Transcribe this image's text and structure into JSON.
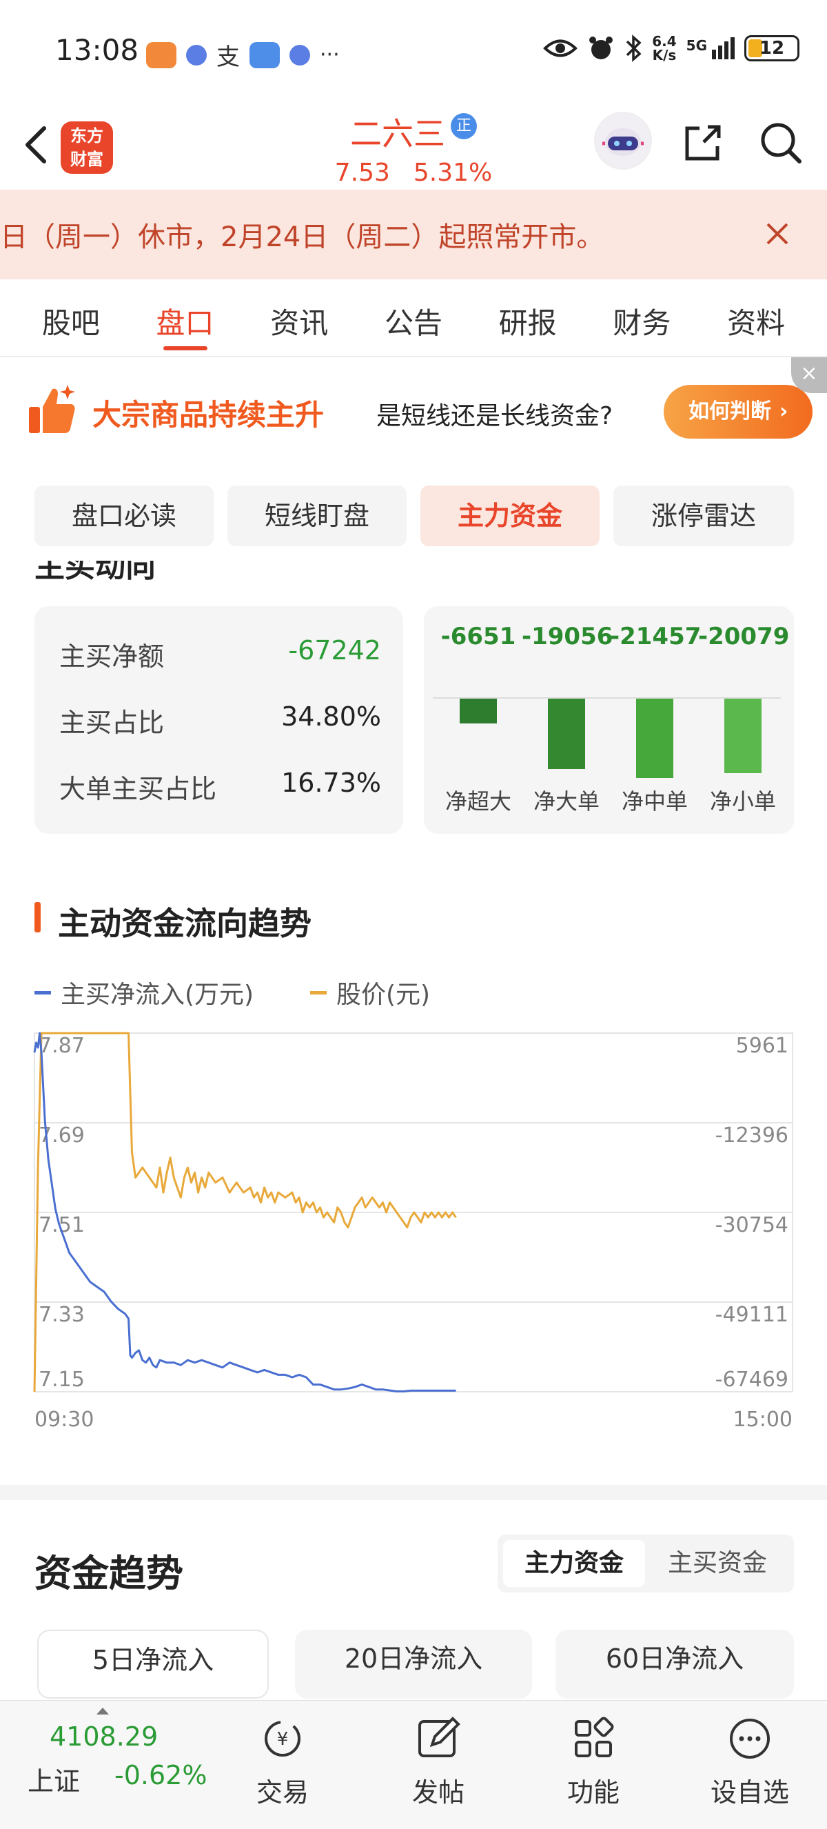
{
  "status_bar": {
    "time": "13:08",
    "net_speed_top": "6.4",
    "net_speed_bottom": "K/s",
    "network": "5G",
    "battery": "12"
  },
  "header": {
    "logo_line1": "东方",
    "logo_line2": "财富",
    "stock_name": "二六三",
    "badge": "正",
    "price": "7.53",
    "change_pct": "5.31%"
  },
  "notice": {
    "text": "日（周一）休市，2月24日（周二）起照常开市。"
  },
  "tabs": [
    {
      "label": "股吧"
    },
    {
      "label": "盘口"
    },
    {
      "label": "资讯"
    },
    {
      "label": "公告"
    },
    {
      "label": "研报"
    },
    {
      "label": "财务"
    },
    {
      "label": "资料"
    }
  ],
  "banner": {
    "headline": "大宗商品持续主升",
    "subline": "是短线还是长线资金?",
    "cta": "如何判断"
  },
  "subtabs": [
    {
      "label": "盘口必读"
    },
    {
      "label": "短线盯盘"
    },
    {
      "label": "主力资金"
    },
    {
      "label": "涨停雷达"
    }
  ],
  "main_buy": {
    "section_peek": "主买动向",
    "rows": [
      {
        "label": "主买净额",
        "value": "-67242"
      },
      {
        "label": "主买占比",
        "value": "34.80%"
      },
      {
        "label": "大单主买占比",
        "value": "16.73%"
      }
    ]
  },
  "flow_breakdown": {
    "items": [
      {
        "label": "净超大",
        "value": "-6651",
        "amount": -6651,
        "color": "#2e7d2e"
      },
      {
        "label": "净大单",
        "value": "-19056",
        "amount": -19056,
        "color": "#34882f"
      },
      {
        "label": "净中单",
        "value": "-21457",
        "amount": -21457,
        "color": "#46a83b"
      },
      {
        "label": "净小单",
        "value": "-20079",
        "amount": -20079,
        "color": "#5bb84d"
      }
    ]
  },
  "trend_chart": {
    "title": "主动资金流向趋势",
    "legend": [
      {
        "name": "主买净流入(万元)",
        "color": "#4a6fd1"
      },
      {
        "name": "股价(元)",
        "color": "#e8a93a"
      }
    ],
    "left_ticks": [
      "7.87",
      "7.69",
      "7.51",
      "7.33",
      "7.15"
    ],
    "right_ticks": [
      "5961",
      "-12396",
      "-30754",
      "-49111",
      "-67469"
    ],
    "x_start": "09:30",
    "x_end": "15:00"
  },
  "chart_data": {
    "type": "line",
    "x_range": [
      "09:30",
      "15:00"
    ],
    "y_left": {
      "label": "股价(元)",
      "ylim": [
        7.15,
        7.87
      ]
    },
    "y_right": {
      "label": "主买净流入(万元)",
      "ylim": [
        -67469,
        5961
      ]
    },
    "grid": true,
    "series": [
      {
        "name": "股价(元)",
        "axis": "left",
        "color": "#e8a93a",
        "x": [
          0,
          2,
          4,
          6,
          10,
          20,
          40,
          50,
          54,
          56,
          58,
          62,
          66,
          70,
          72,
          74,
          76,
          78,
          80,
          82,
          84,
          86,
          88,
          90,
          92,
          94,
          96,
          98,
          100,
          104,
          108,
          112,
          116,
          120,
          124,
          126,
          128,
          130,
          132,
          134,
          136,
          138,
          140,
          144,
          148,
          150,
          152,
          154,
          156,
          158,
          160,
          162,
          164,
          166,
          168,
          170,
          172,
          174,
          176,
          178,
          180,
          182,
          184,
          186,
          188,
          190,
          192,
          194,
          196,
          198,
          200,
          202,
          204,
          206,
          208,
          210,
          212,
          214,
          216,
          218,
          220,
          222,
          224,
          226,
          228,
          230,
          232,
          234,
          236,
          238,
          240,
          242
        ],
        "y": [
          7.15,
          7.6,
          7.87,
          7.87,
          7.87,
          7.87,
          7.87,
          7.87,
          7.87,
          7.63,
          7.58,
          7.6,
          7.58,
          7.56,
          7.6,
          7.55,
          7.59,
          7.62,
          7.58,
          7.56,
          7.54,
          7.58,
          7.6,
          7.57,
          7.59,
          7.55,
          7.58,
          7.56,
          7.59,
          7.57,
          7.58,
          7.55,
          7.57,
          7.55,
          7.56,
          7.54,
          7.55,
          7.53,
          7.56,
          7.54,
          7.55,
          7.53,
          7.55,
          7.54,
          7.55,
          7.53,
          7.54,
          7.51,
          7.53,
          7.52,
          7.53,
          7.51,
          7.52,
          7.5,
          7.51,
          7.5,
          7.49,
          7.52,
          7.51,
          7.49,
          7.48,
          7.5,
          7.52,
          7.53,
          7.54,
          7.52,
          7.53,
          7.54,
          7.53,
          7.52,
          7.53,
          7.51,
          7.53,
          7.52,
          7.51,
          7.5,
          7.49,
          7.48,
          7.5,
          7.51,
          7.5,
          7.49,
          7.51,
          7.5,
          7.51,
          7.5,
          7.51,
          7.5,
          7.51,
          7.5,
          7.51,
          7.5
        ]
      },
      {
        "name": "主买净流入(万元)",
        "axis": "right",
        "color": "#4a6fd1",
        "x": [
          0,
          1,
          2,
          3,
          4,
          6,
          8,
          10,
          12,
          14,
          16,
          18,
          20,
          24,
          28,
          32,
          36,
          40,
          44,
          48,
          52,
          54,
          55,
          56,
          58,
          60,
          62,
          64,
          66,
          68,
          70,
          72,
          76,
          80,
          84,
          88,
          92,
          96,
          100,
          104,
          108,
          112,
          116,
          120,
          124,
          128,
          132,
          136,
          140,
          144,
          148,
          152,
          156,
          160,
          164,
          168,
          172,
          176,
          180,
          184,
          188,
          192,
          196,
          200,
          204,
          208,
          212,
          216,
          220,
          224,
          228,
          232,
          236,
          240,
          242
        ],
        "y": [
          2000,
          4000,
          3000,
          5961,
          2000,
          -12000,
          -20000,
          -25000,
          -30000,
          -33000,
          -35000,
          -37000,
          -39000,
          -41000,
          -43000,
          -45000,
          -46000,
          -47000,
          -49000,
          -50500,
          -51500,
          -52500,
          -60000,
          -60500,
          -59500,
          -59000,
          -61000,
          -61500,
          -60500,
          -62000,
          -62500,
          -61000,
          -61500,
          -61500,
          -62000,
          -61000,
          -61500,
          -61000,
          -61500,
          -62000,
          -62500,
          -61500,
          -62000,
          -62500,
          -63000,
          -63500,
          -63000,
          -63500,
          -64000,
          -64000,
          -64500,
          -64000,
          -64500,
          -66000,
          -66000,
          -66500,
          -67000,
          -67000,
          -66800,
          -66500,
          -66000,
          -66500,
          -67000,
          -67000,
          -67200,
          -67400,
          -67400,
          -67242,
          -67242,
          -67242,
          -67242,
          -67242,
          -67242,
          -67242,
          -67242
        ]
      }
    ]
  },
  "trend": {
    "title": "资金趋势",
    "segments": [
      {
        "label": "主力资金"
      },
      {
        "label": "主买资金"
      }
    ],
    "periods": [
      {
        "label": "5日净流入"
      },
      {
        "label": "20日净流入"
      },
      {
        "label": "60日净流入"
      }
    ]
  },
  "bottom_bar": {
    "index_value": "4108.29",
    "index_name": "上证",
    "index_change": "-0.62%",
    "items": [
      {
        "label": "交易",
        "icon": "trade-icon"
      },
      {
        "label": "发帖",
        "icon": "post-icon"
      },
      {
        "label": "功能",
        "icon": "apps-icon"
      },
      {
        "label": "设自选",
        "icon": "more-icon"
      }
    ]
  }
}
